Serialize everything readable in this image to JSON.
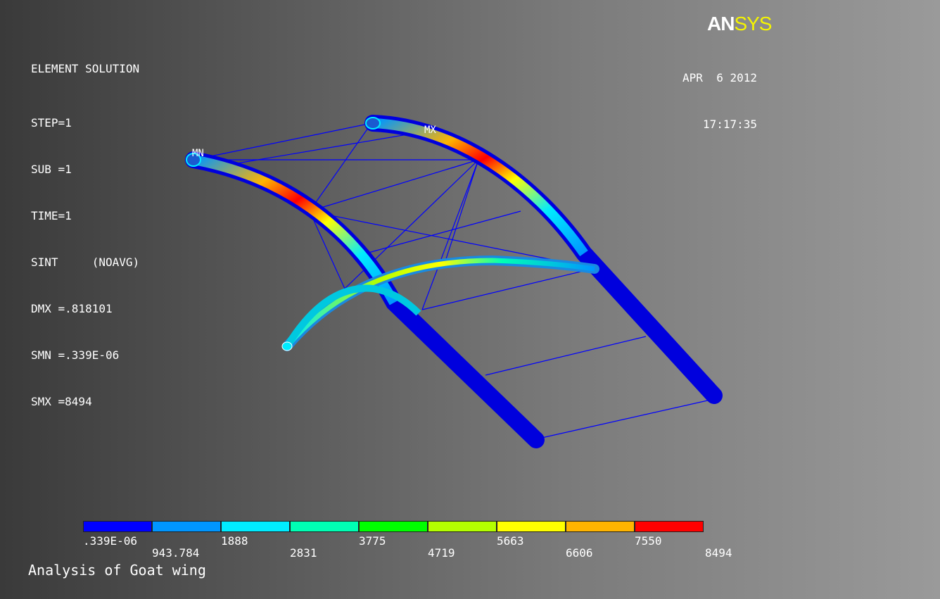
{
  "logo": {
    "an": "AN",
    "sys": "SYS"
  },
  "status": {
    "title": "ELEMENT SOLUTION",
    "step": "STEP=1",
    "sub": "SUB =1",
    "time": "TIME=1",
    "sint": "SINT     (NOAVG)",
    "dmx": "DMX =.818101",
    "smn": "SMN =.339E-06",
    "smx": "SMX =8494"
  },
  "date": {
    "date": "APR  6 2012",
    "time": "17:17:35"
  },
  "markers": {
    "min": "MN",
    "max": "MX"
  },
  "legend": {
    "colors": [
      "#0000ff",
      "#0096ff",
      "#00ecff",
      "#00ffb4",
      "#00ff00",
      "#b4ff00",
      "#ffff00",
      "#ffb400",
      "#ff0000"
    ],
    "labels_top": [
      ".339E-06",
      "1888",
      "3775",
      "5663",
      "7550"
    ],
    "labels_bottom": [
      "943.784",
      "2831",
      "4719",
      "6606",
      "8494"
    ]
  },
  "caption": "Analysis of Goat wing"
}
